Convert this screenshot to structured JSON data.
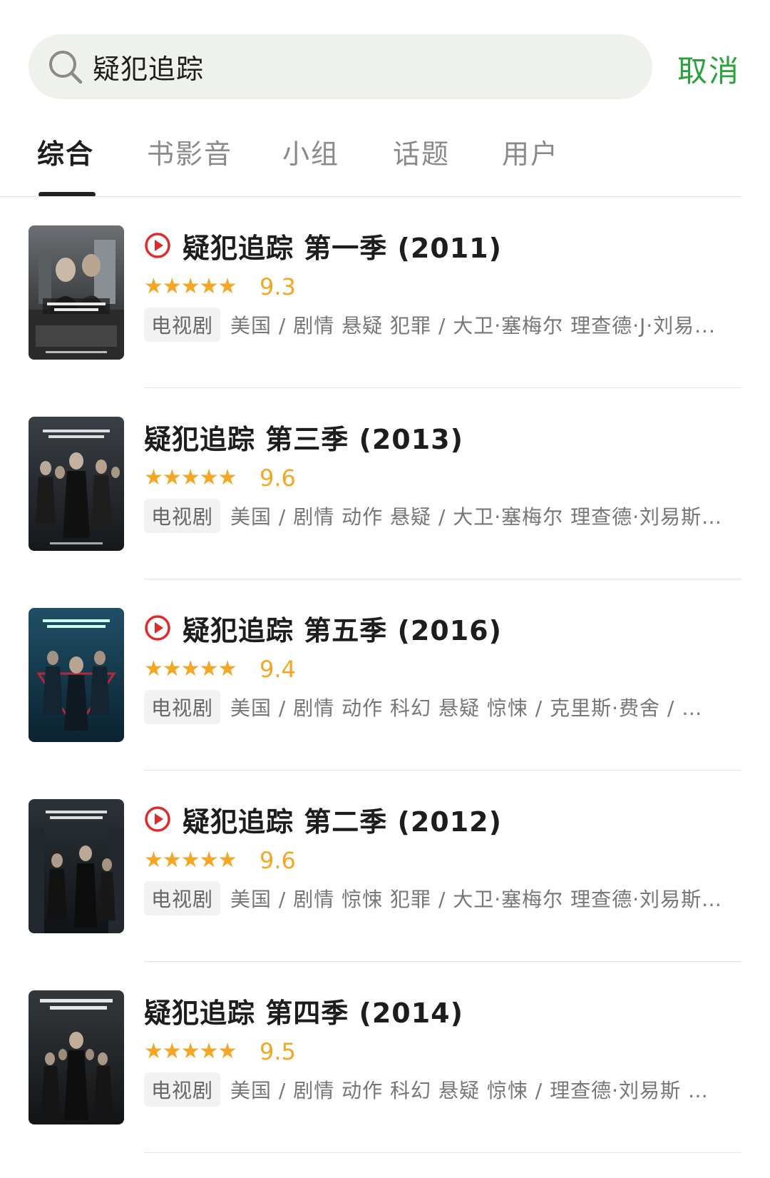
{
  "search": {
    "query": "疑犯追踪",
    "cancel_label": "取消"
  },
  "tabs": [
    {
      "label": "综合",
      "active": true
    },
    {
      "label": "书影音",
      "active": false
    },
    {
      "label": "小组",
      "active": false
    },
    {
      "label": "话题",
      "active": false
    },
    {
      "label": "用户",
      "active": false
    }
  ],
  "colors": {
    "accent_green": "#2aa33a",
    "star_orange": "#f5a623",
    "play_red": "#e02a2a"
  },
  "results": [
    {
      "title": "疑犯追踪  第一季 (2011)",
      "has_play": true,
      "rating_stars": 4.5,
      "score": "9.3",
      "type": "电视剧",
      "meta": "美国 / 剧情 悬疑 犯罪 / 大卫·塞梅尔 理查德·J·刘易..."
    },
    {
      "title": "疑犯追踪 第三季 (2013)",
      "has_play": false,
      "rating_stars": 5,
      "score": "9.6",
      "type": "电视剧",
      "meta": "美国 / 剧情 动作 悬疑 / 大卫·塞梅尔 理查德·刘易斯..."
    },
    {
      "title": "疑犯追踪 第五季 (2016)",
      "has_play": true,
      "rating_stars": 4.5,
      "score": "9.4",
      "type": "电视剧",
      "meta": "美国 / 剧情 动作 科幻 悬疑 惊悚 / 克里斯·费舍 / 吉..."
    },
    {
      "title": "疑犯追踪 第二季 (2012)",
      "has_play": true,
      "rating_stars": 5,
      "score": "9.6",
      "type": "电视剧",
      "meta": "美国 / 剧情 惊悚 犯罪 / 大卫·塞梅尔 理查德·刘易斯..."
    },
    {
      "title": "疑犯追踪 第四季 (2014)",
      "has_play": false,
      "rating_stars": 5,
      "score": "9.5",
      "type": "电视剧",
      "meta": "美国 / 剧情 动作 科幻 悬疑 惊悚 / 理查德·刘易斯 大..."
    }
  ]
}
